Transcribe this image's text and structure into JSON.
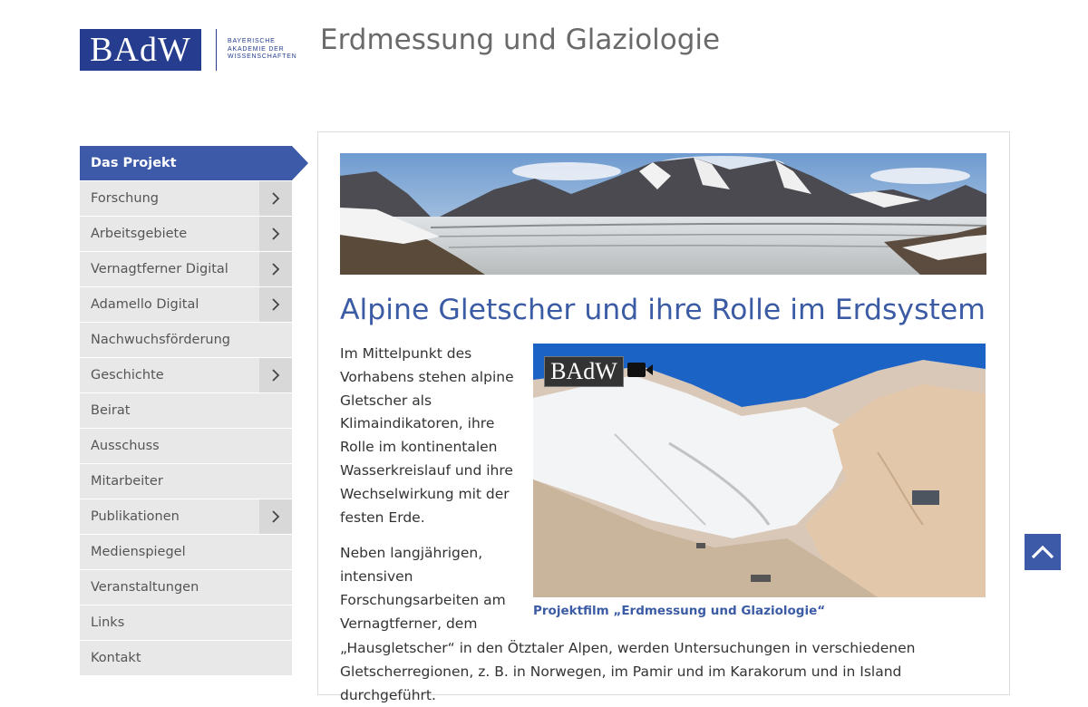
{
  "header": {
    "logo_text": "BAdW",
    "logo_subtitle": "Bayerische Akademie der Wissenschaften",
    "site_title": "Erdmessung und Glaziologie"
  },
  "nav": {
    "items": [
      {
        "label": "Das Projekt",
        "active": true,
        "has_children": false
      },
      {
        "label": "Forschung",
        "has_children": true
      },
      {
        "label": "Arbeitsgebiete",
        "has_children": true
      },
      {
        "label": "Vernagtferner Digital",
        "has_children": true
      },
      {
        "label": "Adamello Digital",
        "has_children": true
      },
      {
        "label": "Nachwuchsförderung",
        "has_children": false
      },
      {
        "label": "Geschichte",
        "has_children": true
      },
      {
        "label": "Beirat",
        "has_children": false
      },
      {
        "label": "Ausschuss",
        "has_children": false
      },
      {
        "label": "Mitarbeiter",
        "has_children": false
      },
      {
        "label": "Publikationen",
        "has_children": true
      },
      {
        "label": "Medienspiegel",
        "has_children": false
      },
      {
        "label": "Veranstaltungen",
        "has_children": false
      },
      {
        "label": "Links",
        "has_children": false
      },
      {
        "label": "Kontakt",
        "has_children": false
      }
    ]
  },
  "content": {
    "title": "Alpine Gletscher und ihre Rolle im Erdsystem",
    "paragraph1": "Im Mittelpunkt des Vorhabens stehen alpine Gletscher als Klimaindikatoren, ihre Rolle im kontinentalen Wasserkreislauf und ihre Wechselwirkung mit der festen Erde.",
    "paragraph2_start": "Neben langjährigen, intensiven Forschungsarbeiten am Vernagtferner, dem",
    "paragraph2_cont": "„Hausgletscher“ in den Ötztaler Alpen, werden Untersuchungen in verschiedenen Gletscherregionen, z. B. in Norwegen, im Pamir und im Karakorum und in Island durchgeführt.",
    "video_logo": "BAdW",
    "video_caption": "Projektfilm „Erdmessung und Glaziologie“"
  },
  "icons": {
    "chevron": "chevron-right-icon",
    "camera": "video-camera-icon",
    "back_to_top": "chevron-up-icon"
  },
  "colors": {
    "brand": "#253c8f",
    "accent": "#3d5aa8",
    "link": "#3b5ba5"
  }
}
